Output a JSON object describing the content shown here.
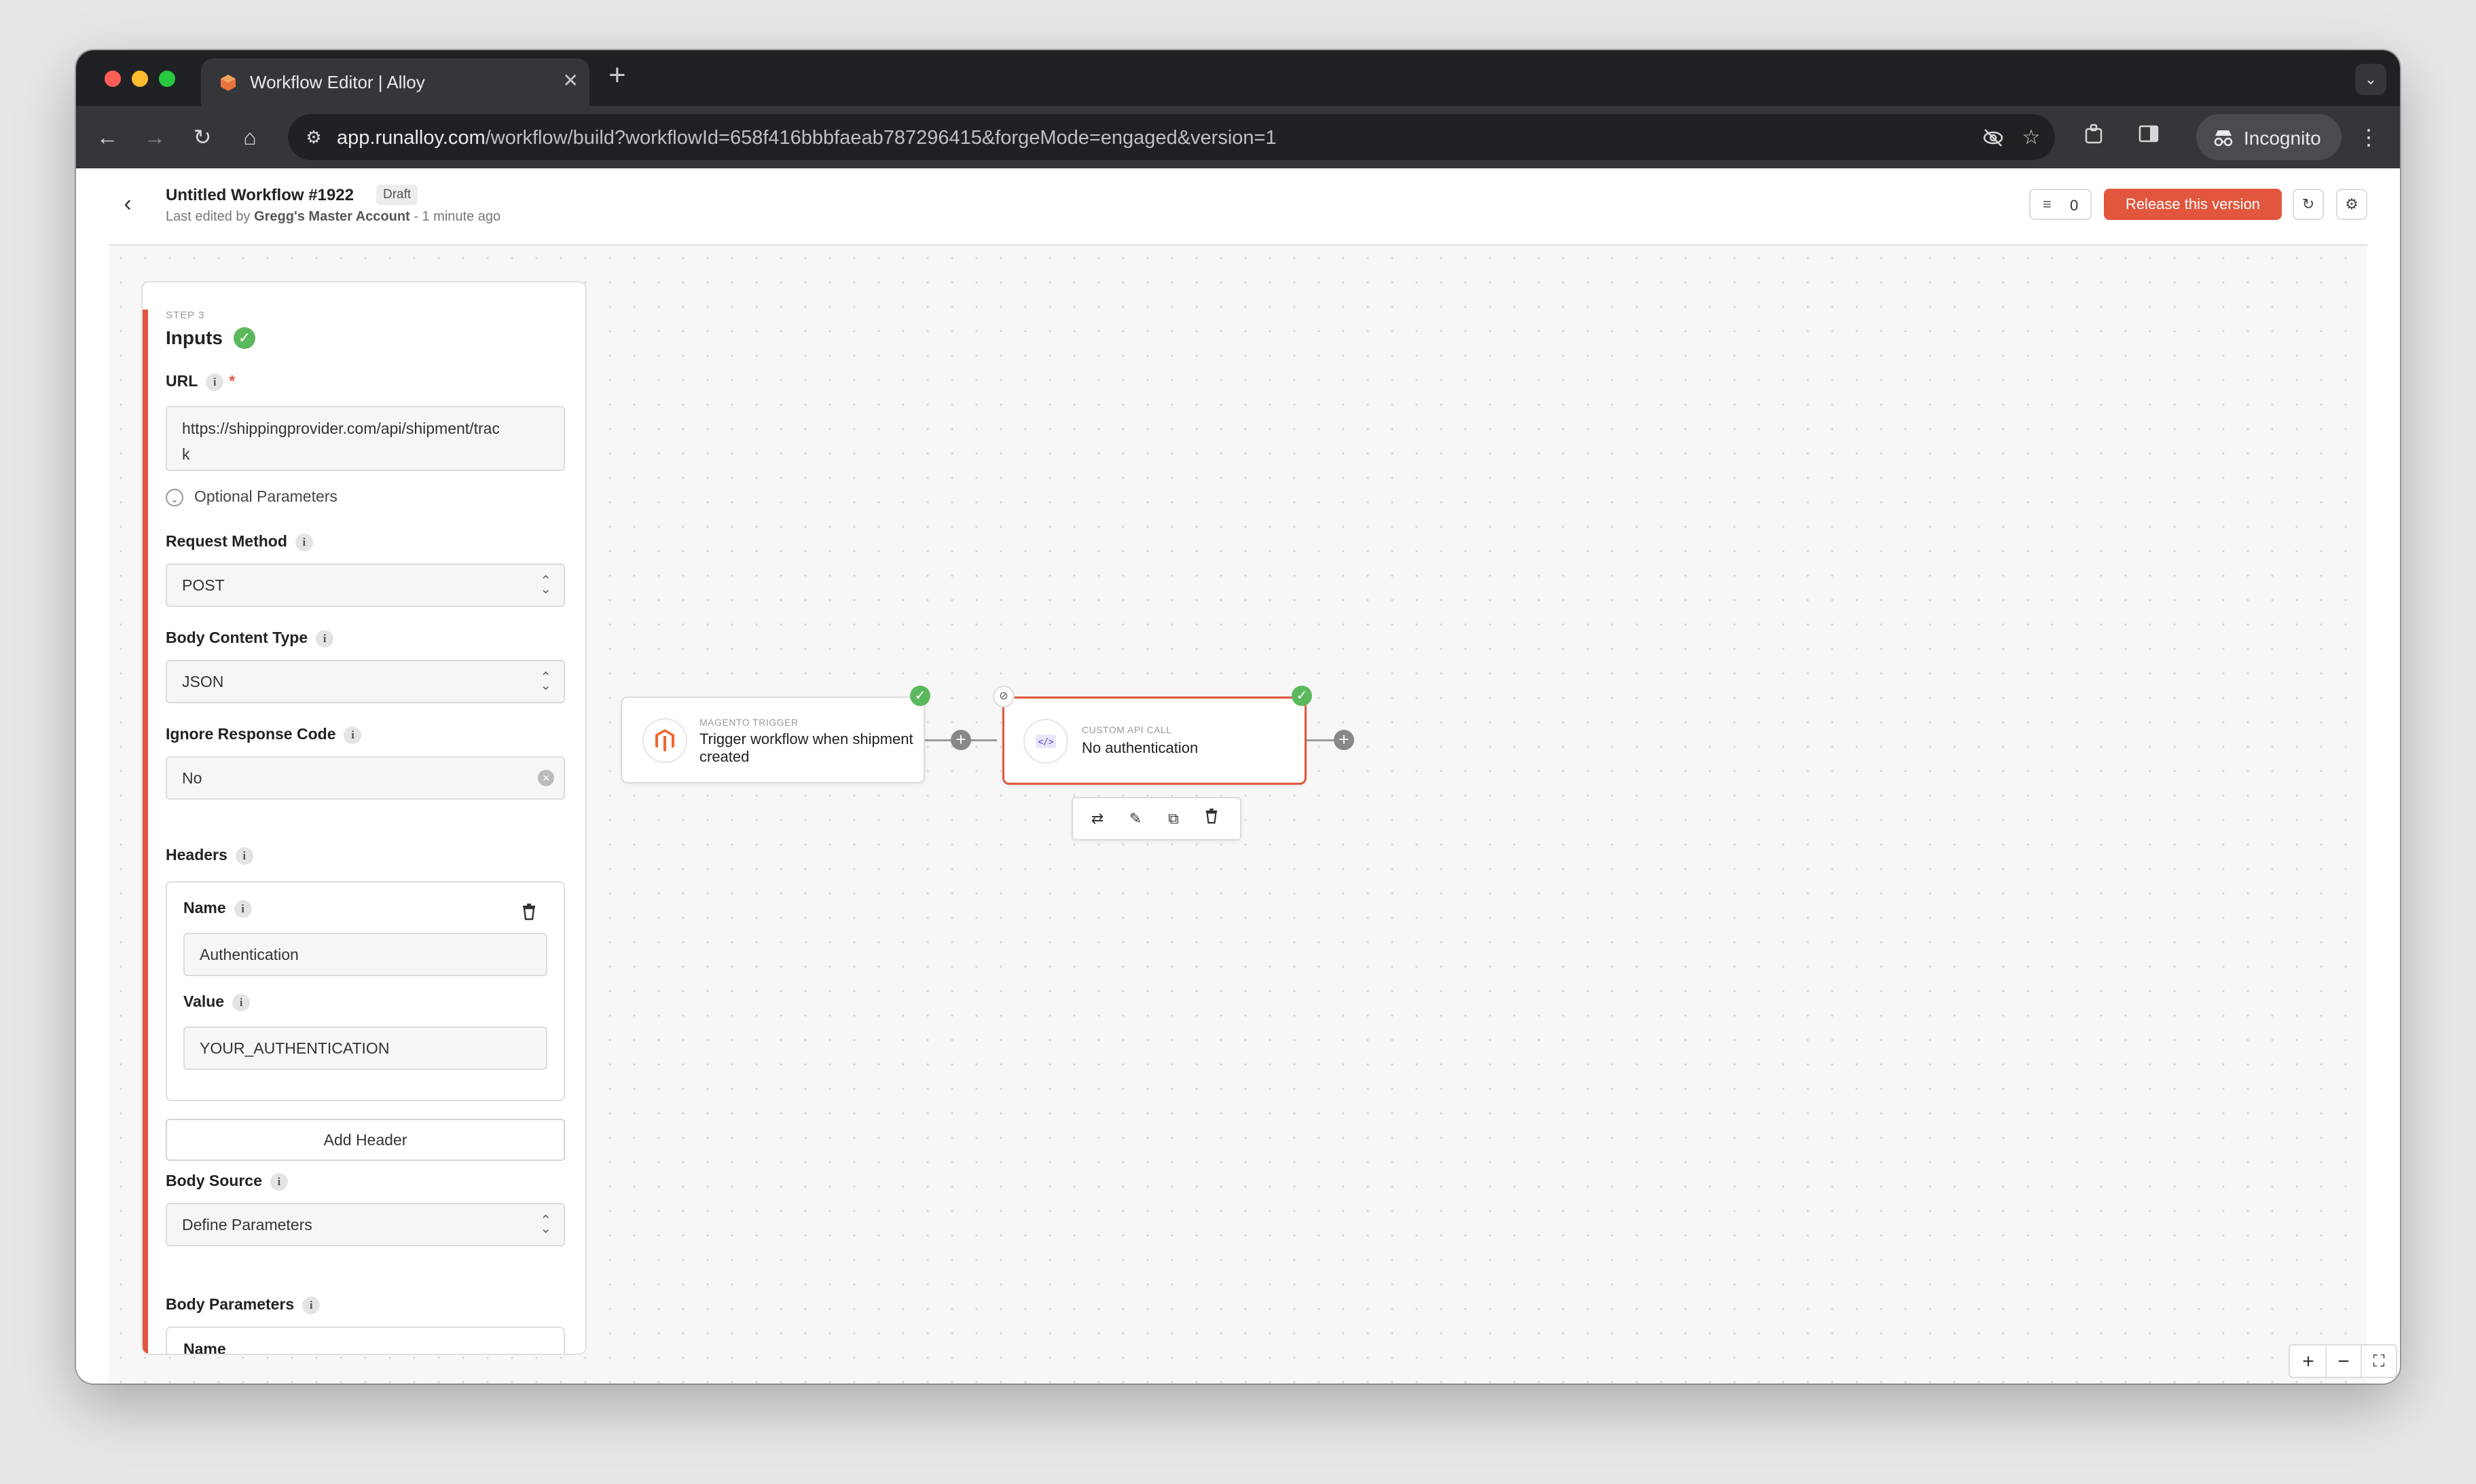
{
  "browser": {
    "tab_title": "Workflow Editor | Alloy",
    "url_host": "app.runalloy.com",
    "url_path": "/workflow/build?workflowId=658f416bbbfaeab787296415&forgeMode=engaged&version=1",
    "profile_label": "Incognito"
  },
  "header": {
    "workflow_title": "Untitled Workflow #1922",
    "status_badge": "Draft",
    "last_edited_prefix": "Last edited by",
    "last_edited_user": "Gregg's Master Account",
    "last_edited_suffix": "- 1 minute ago",
    "issues_count": "0",
    "release_label": "Release this version"
  },
  "panel": {
    "step_label": "STEP 3",
    "heading": "Inputs",
    "url_label": "URL",
    "url_value_line1": "https://shippingprovider.com/api/shipment/trac",
    "url_value_line2": "k",
    "optional_params_label": "Optional Parameters",
    "request_method_label": "Request Method",
    "request_method_value": "POST",
    "body_content_type_label": "Body Content Type",
    "body_content_type_value": "JSON",
    "ignore_response_label": "Ignore Response Code",
    "ignore_response_value": "No",
    "headers_label": "Headers",
    "header_name_label": "Name",
    "header_name_value": "Authentication",
    "header_value_label": "Value",
    "header_value_value": "YOUR_AUTHENTICATION",
    "add_header_label": "Add Header",
    "body_source_label": "Body Source",
    "body_source_value": "Define Parameters",
    "body_params_label": "Body Parameters",
    "body_params_name_partial": "Name"
  },
  "nodes": {
    "trigger": {
      "type_label": "MAGENTO TRIGGER",
      "description": "Trigger workflow when shipment created"
    },
    "api_call": {
      "type_label": "CUSTOM API CALL",
      "description": "No authentication"
    }
  },
  "colors": {
    "accent": "#e2563d",
    "success": "#5cb85c",
    "magento": "#ee672f"
  },
  "icons": {
    "node_toolbar": [
      "swap-icon",
      "edit-icon",
      "duplicate-icon",
      "trash-icon"
    ],
    "zoom": [
      "zoom-in-icon",
      "zoom-out-icon",
      "fit-view-icon",
      "settings-icon"
    ]
  }
}
